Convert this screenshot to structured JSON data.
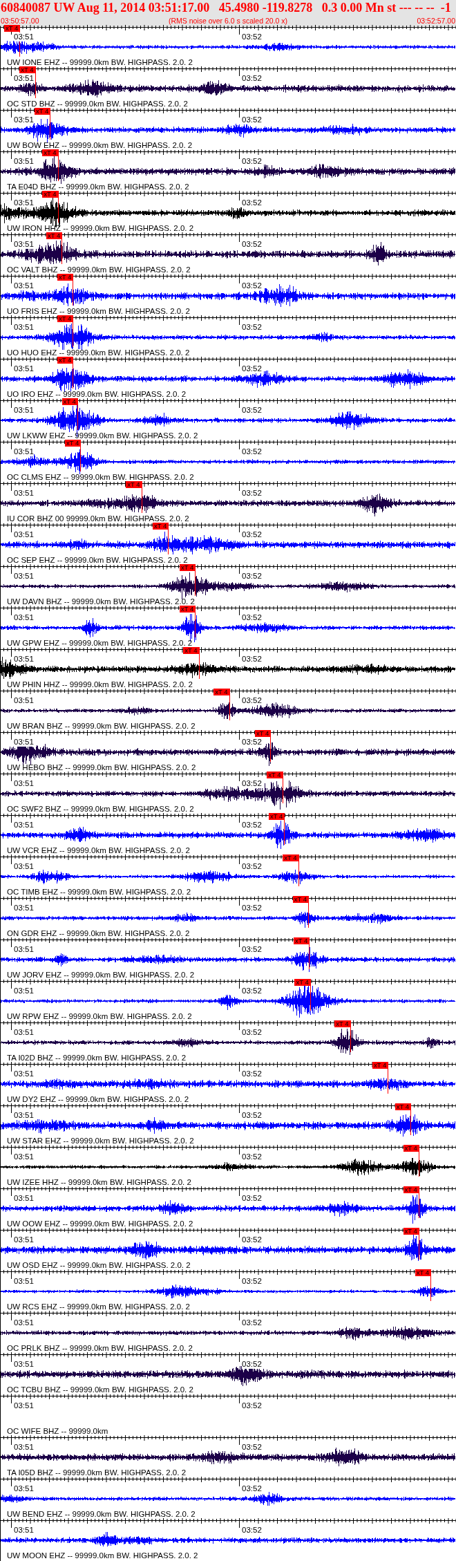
{
  "header": {
    "title": "60840087 UW Aug 11, 2014 03:51:17.00   45.4980 -119.8278   0.3 0.00 Mn st --- -- --  -1",
    "start_time": "03:50:57.00",
    "note": "(RMS noise over 6.0 s scaled 20.0 x)",
    "end_time": "03:52:57.00"
  },
  "traces": [
    {
      "station": "UW IONE EHZ -- 99999.0km BW. HIGHPASS. 2.0. 2",
      "time_labels": [
        "03:51",
        "03:52"
      ],
      "kind": "wave",
      "color": "#0000ff",
      "pick": {
        "label": "xT 4",
        "level": 0.009
      }
    },
    {
      "station": "OC STD BHZ -- 99999.0km BW. HIGHPASS. 2.0. 2",
      "time_labels": [
        "03:51",
        "03:52"
      ],
      "kind": "wave",
      "color": "#1c0048",
      "pick": {
        "label": "xT 4",
        "level": 0.043
      }
    },
    {
      "station": "UW BOW EHZ -- 99999.0km BW. HIGHPASS. 2.0. 2",
      "time_labels": [
        "03:51",
        "03:52"
      ],
      "kind": "wave",
      "color": "#0000ff",
      "pick": {
        "label": "xT 4",
        "level": 0.076
      }
    },
    {
      "station": "TA E04D BHZ -- 99999.0km BW. HIGHPASS. 2.0. 2",
      "time_labels": [
        "03:51",
        "03:52"
      ],
      "kind": "wave",
      "color": "#1c0048",
      "pick": {
        "label": "xT 4",
        "level": 0.093
      }
    },
    {
      "station": "UW IRON HHZ -- 99999.0km BW. HIGHPASS. 2.0. 2",
      "time_labels": [
        "03:51",
        "03:52"
      ],
      "kind": "wave",
      "color": "#000000",
      "pick": {
        "label": "xT 4",
        "level": 0.093
      }
    },
    {
      "station": "OC VALT BHZ -- 99999.0km BW. HIGHPASS. 2.0. 2",
      "time_labels": [
        "03:51",
        "03:52"
      ],
      "kind": "wave",
      "color": "#1c0048",
      "pick": {
        "label": "xT 4",
        "level": 0.102
      }
    },
    {
      "station": "UO FRIS EHZ -- 99999.0km BW. HIGHPASS. 2.0. 2",
      "time_labels": [
        "03:51",
        "03:52"
      ],
      "kind": "wave",
      "color": "#0000ff",
      "pick": {
        "label": "xT 4",
        "level": 0.126
      }
    },
    {
      "station": "UO HUO EHZ -- 99999.0km BW. HIGHPASS. 2.0. 2",
      "time_labels": [
        "03:51",
        "03:52"
      ],
      "kind": "wave",
      "color": "#0000ff",
      "pick": {
        "label": "xT 4",
        "level": 0.126
      }
    },
    {
      "station": "UO IRO EHZ -- 99999.0km BW. HIGHPASS. 2.0. 2",
      "time_labels": [
        "03:51",
        "03:52"
      ],
      "kind": "wave",
      "color": "#0000ff",
      "pick": {
        "label": "xT 4",
        "level": 0.126
      }
    },
    {
      "station": "UW LKWW EHZ -- 99999.0km BW. HIGHPASS. 2.0. 2",
      "time_labels": [
        "03:51",
        "03:52"
      ],
      "kind": "wave",
      "color": "#0000ff",
      "pick": {
        "label": "xT 4",
        "level": 0.136
      }
    },
    {
      "station": "OC CLMS EHZ -- 99999.0km BW. HIGHPASS. 2.0. 2",
      "time_labels": [
        "03:51",
        "03:52"
      ],
      "kind": "wave",
      "color": "#0000ff",
      "pick": {
        "label": "xT 4",
        "level": 0.143
      }
    },
    {
      "station": "IU COR BHZ 00 99999.0km BW. HIGHPASS. 2.0. 2",
      "time_labels": [
        "03:51",
        "03:52"
      ],
      "kind": "wave",
      "color": "#1c0048",
      "pick": {
        "label": "xT 4",
        "level": 0.277
      }
    },
    {
      "station": "OC SEP EHZ -- 99999.0km BW. HIGHPASS. 2.0. 2",
      "time_labels": [
        "03:51",
        "03:52"
      ],
      "kind": "wave",
      "color": "#0000ff",
      "pick": {
        "label": "xT 4",
        "level": 0.336
      }
    },
    {
      "station": "UW DAVN BHZ -- 99999.0km BW. HIGHPASS. 2.0. 2",
      "time_labels": [
        "03:51",
        "03:52"
      ],
      "kind": "wave",
      "color": "#1c0048",
      "pick": {
        "label": "xT 4",
        "level": 0.395
      }
    },
    {
      "station": "UW GPW EHZ -- 99999.0km BW. HIGHPASS. 2.0. 2",
      "time_labels": [
        "03:51",
        "03:52"
      ],
      "kind": "wave",
      "color": "#0000ff",
      "pick": {
        "label": "xT 4",
        "level": 0.395
      }
    },
    {
      "station": "UW PHIN HHZ -- 99999.0km BW. HIGHPASS. 2.0. 2",
      "time_labels": [
        "03:51",
        "03:52"
      ],
      "kind": "wave",
      "color": "#000000",
      "pick": {
        "label": "xT 4",
        "level": 0.403
      }
    },
    {
      "station": "UW BRAN BHZ -- 99999.0km BW. HIGHPASS. 2.0. 2",
      "time_labels": [
        "03:51",
        "03:52"
      ],
      "kind": "wave",
      "color": "#1c0048",
      "pick": {
        "label": "xT 4",
        "level": 0.47
      }
    },
    {
      "station": "UW HEBO BHZ -- 99999.0km BW. HIGHPASS. 2.0. 2",
      "time_labels": [
        "03:51",
        "03:52"
      ],
      "kind": "wave",
      "color": "#1c0048",
      "pick": {
        "label": "xT 4",
        "level": 0.561
      }
    },
    {
      "station": "OC SWF2 BHZ -- 99999.0km BW. HIGHPASS. 2.0. 2",
      "time_labels": [
        "03:51",
        "03:52"
      ],
      "kind": "wave",
      "color": "#1c0048",
      "pick": {
        "label": "xT 4",
        "level": 0.587
      }
    },
    {
      "station": "UW VCR EHZ -- 99999.0km BW. HIGHPASS. 2.0. 2",
      "time_labels": [
        "03:51",
        "03:52"
      ],
      "kind": "wave",
      "color": "#0000ff",
      "pick": {
        "label": "xT 4",
        "level": 0.591
      }
    },
    {
      "station": "OC TIMB EHZ -- 99999.0km BW. HIGHPASS. 2.0. 2",
      "time_labels": [
        "03:51",
        "03:52"
      ],
      "kind": "wave",
      "color": "#0000ff",
      "pick": {
        "label": "xT 4",
        "level": 0.622
      }
    },
    {
      "station": "ON GDR EHZ -- 99999.0km BW. HIGHPASS. 2.0. 2",
      "time_labels": [
        "03:51",
        "03:52"
      ],
      "kind": "wave",
      "color": "#0000ff",
      "pick": {
        "label": "xT 4",
        "level": 0.644
      }
    },
    {
      "station": "UW JORV EHZ -- 99999.0km BW. HIGHPASS. 2.0. 2",
      "time_labels": [
        "03:51",
        "03:52"
      ],
      "kind": "wave",
      "color": "#0000ff",
      "pick": {
        "label": "xT 4",
        "level": 0.646
      }
    },
    {
      "station": "UW RPW EHZ -- 99999.0km BW. HIGHPASS. 2.0. 2",
      "time_labels": [
        "03:51",
        "03:52"
      ],
      "kind": "wave",
      "color": "#0000ff",
      "pick": {
        "label": "xT 4",
        "level": 0.648
      }
    },
    {
      "station": "TA I02D BHZ -- 99999.0km BW. HIGHPASS. 2.0. 2",
      "time_labels": [
        "03:51",
        "03:52"
      ],
      "kind": "wave",
      "color": "#1c0048",
      "pick": {
        "label": "xT 4",
        "level": 0.736
      }
    },
    {
      "station": "UW DY2 EHZ -- 99999.0km BW. HIGHPASS. 2.0. 2",
      "time_labels": [
        "03:51",
        "03:52"
      ],
      "kind": "wave",
      "color": "#0000ff",
      "pick": {
        "label": "xT 4",
        "level": 0.819
      }
    },
    {
      "station": "UW STAR EHZ -- 99999.0km BW. HIGHPASS. 2.0. 2",
      "time_labels": [
        "03:51",
        "03:52"
      ],
      "kind": "wave",
      "color": "#0000ff",
      "pick": {
        "label": "xT 4",
        "level": 0.869
      }
    },
    {
      "station": "UW IZEE HHZ -- 99999.0km BW. HIGHPASS. 2.0. 2",
      "time_labels": [
        "03:51",
        "03:52"
      ],
      "kind": "wave",
      "color": "#000000",
      "pick": {
        "label": "xT 4",
        "level": 0.887
      }
    },
    {
      "station": "UW OOW EHZ -- 99999.0km BW. HIGHPASS. 2.0. 2",
      "time_labels": [
        "03:51",
        "03:52"
      ],
      "kind": "wave",
      "color": "#0000ff",
      "pick": {
        "label": "xT 4",
        "level": 0.887
      }
    },
    {
      "station": "UW OSD EHZ -- 99999.0km BW. HIGHPASS. 2.0. 2",
      "time_labels": [
        "03:51",
        "03:52"
      ],
      "kind": "wave",
      "color": "#0000ff",
      "pick": {
        "label": "xT 4",
        "level": 0.887
      }
    },
    {
      "station": "UW RCS EHZ -- 99999.0km BW. HIGHPASS. 2.0. 2",
      "time_labels": [
        "03:51",
        "03:52"
      ],
      "kind": "wave",
      "color": "#0000ff",
      "pick": {
        "label": "xT 4",
        "level": 0.913
      }
    },
    {
      "station": "OC PRLK BHZ -- 99999.0km BW. HIGHPASS. 2.0. 2",
      "time_labels": [
        "03:51",
        "03:52"
      ],
      "kind": "wave",
      "color": "#1c0048"
    },
    {
      "station": "OC TCBU BHZ -- 99999.0km BW. HIGHPASS. 2.0. 2",
      "time_labels": [
        "03:51",
        "03:52"
      ],
      "kind": "wave",
      "color": "#1c0048"
    },
    {
      "station": "OC WIFE BHZ -- 99999.0km",
      "time_labels": [
        "03:51",
        "03:52"
      ],
      "kind": "blank"
    },
    {
      "station": "TA I05D BHZ -- 99999.0km BW. HIGHPASS. 2.0. 2",
      "time_labels": [
        "03:51",
        "03:52"
      ],
      "kind": "wave",
      "color": "#1c0048"
    },
    {
      "station": "UW BEND EHZ -- 99999.0km BW. HIGHPASS. 2.0. 2",
      "time_labels": [
        "03:51",
        "03:52"
      ],
      "kind": "wave",
      "color": "#0000ff"
    },
    {
      "station": "UW MOON EHZ -- 99999.0km BW. HIGHPASS. 2.0. 2",
      "time_labels": [
        "03:51",
        "03:52"
      ],
      "kind": "wave",
      "color": "#0000ff"
    }
  ]
}
